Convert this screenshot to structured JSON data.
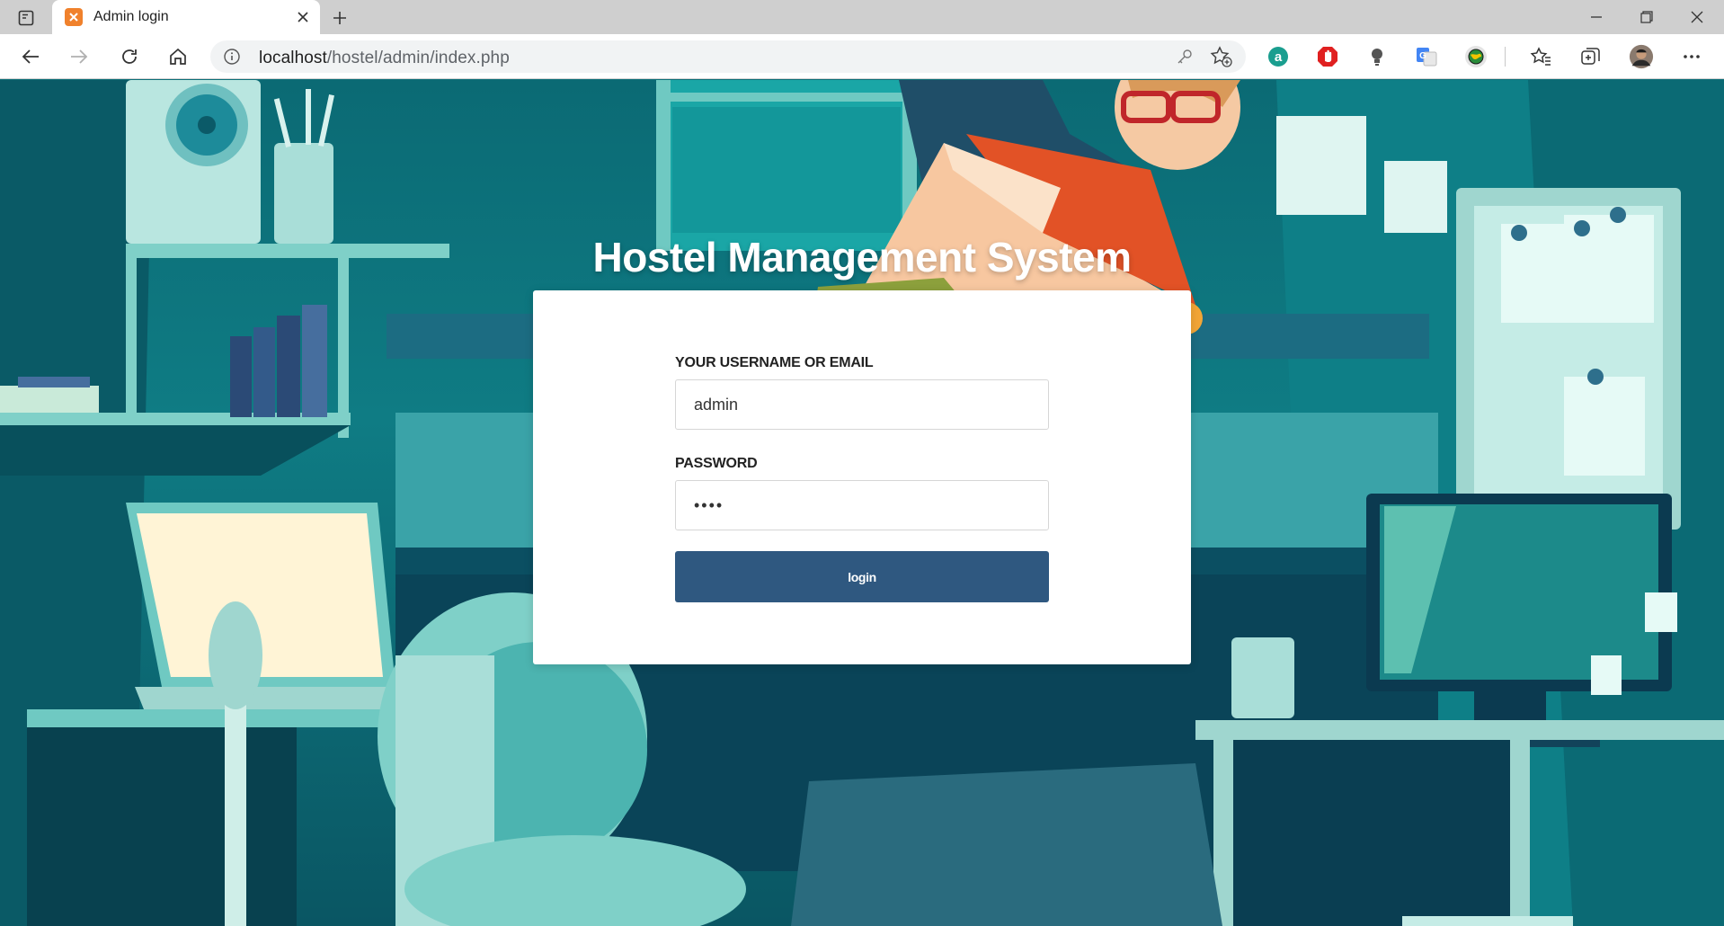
{
  "browser": {
    "tab_title": "Admin login",
    "address": {
      "host": "localhost",
      "path": "/hostel/admin/index.php"
    },
    "extensions": [
      "amazon-assistant-icon",
      "adblock-icon",
      "lightbulb-icon",
      "translate-icon",
      "globe-icon"
    ]
  },
  "page": {
    "heading": "Hostel Management System",
    "form": {
      "username_label": "YOUR USERNAME OR EMAIL",
      "username_value": "admin",
      "password_label": "PASSWORD",
      "password_value": "••••",
      "login_label": "login"
    }
  },
  "colors": {
    "accent": "#2f5880",
    "background": "#0d6f78"
  }
}
